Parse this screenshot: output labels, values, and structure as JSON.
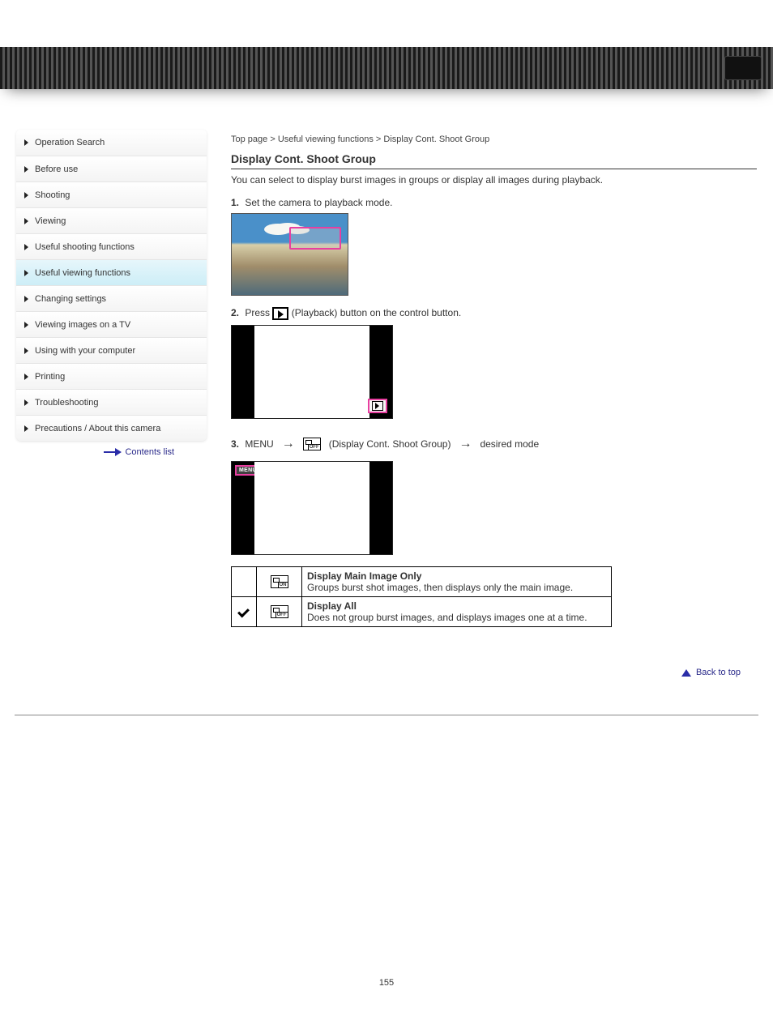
{
  "sidebar": {
    "items": [
      {
        "label": "Operation Search"
      },
      {
        "label": "Before use"
      },
      {
        "label": "Shooting"
      },
      {
        "label": "Viewing"
      },
      {
        "label": "Useful shooting functions"
      },
      {
        "label": "Useful viewing functions"
      },
      {
        "label": "Changing settings"
      },
      {
        "label": "Viewing images on a TV"
      },
      {
        "label": "Using with your computer"
      },
      {
        "label": "Printing"
      },
      {
        "label": "Troubleshooting"
      },
      {
        "label": "Precautions / About this camera"
      }
    ],
    "active_index": 5,
    "back_label": "Contents list"
  },
  "content": {
    "breadcrumb_prefix": "Top page",
    "breadcrumb_section": "Useful viewing functions",
    "title": "Display Cont. Shoot Group",
    "subtitle": "You can select to display burst images in groups or display all images during playback.",
    "steps": [
      {
        "num": "1.",
        "text": "Set the camera to playback mode."
      },
      {
        "num": "2.",
        "pre": "Press",
        "post": "(Playback) button on the control button."
      },
      {
        "num": "3.",
        "pre": "MENU",
        "mid": "(Display Cont. Shoot Group)",
        "post": "desired mode"
      }
    ],
    "badge_text": "MENU",
    "table": {
      "rows": [
        {
          "checked": false,
          "icon_sub": "ON",
          "label": "Display Main Image Only",
          "desc": "Groups burst shot images, then displays only the main image."
        },
        {
          "checked": true,
          "icon_sub": "OFF",
          "label": "Display All",
          "desc": "Does not group burst images, and displays images one at a time."
        }
      ]
    }
  },
  "footer": {
    "back_to_top": "Back to top",
    "page_number": "155"
  }
}
